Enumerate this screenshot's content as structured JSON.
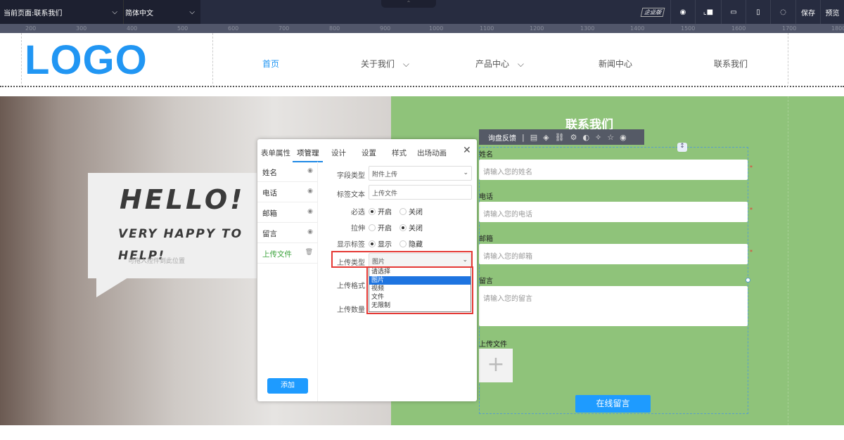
{
  "topbar": {
    "current_page": "当前页面:联系我们",
    "language": "简体中文",
    "edition_badge": "企业版",
    "save": "保存",
    "preview": "预览"
  },
  "ruler": [
    "200",
    "300",
    "400",
    "500",
    "600",
    "700",
    "800",
    "900",
    "1000",
    "1100",
    "1200",
    "1300",
    "1400",
    "1500",
    "1600",
    "1700",
    "1800"
  ],
  "header": {
    "logo": "LOGO",
    "nav": [
      "首页",
      "关于我们",
      "产品中心",
      "新闻中心",
      "联系我们"
    ],
    "active_color": "#2196f3"
  },
  "hero": {
    "hello": "HELLO!",
    "subtitle": "VERY HAPPY TO HELP!",
    "drop_hint": "可拖入控件到此位置"
  },
  "contact": {
    "title": "联系我们",
    "toolbar_label": "询盘反馈",
    "fields": [
      {
        "label": "姓名",
        "placeholder": "请输入您的姓名"
      },
      {
        "label": "电话",
        "placeholder": "请输入您的电话"
      },
      {
        "label": "邮箱",
        "placeholder": "请输入您的邮箱"
      },
      {
        "label": "留言",
        "placeholder": "请输入您的留言"
      }
    ],
    "upload_label": "上传文件",
    "submit": "在线留言",
    "accent": "#8fc37a"
  },
  "dialog": {
    "tabs": [
      "表单属性",
      "项管理",
      "设计",
      "设置",
      "样式",
      "出场动画"
    ],
    "active_tab": "项管理",
    "items": [
      "姓名",
      "电话",
      "邮箱",
      "留言",
      "上传文件"
    ],
    "add": "添加",
    "props": {
      "field_type_label": "字段类型",
      "field_type": "附件上传",
      "label_text_label": "标签文本",
      "label_text": "上传文件",
      "required_label": "必选",
      "stretch_label": "拉伸",
      "show_label_label": "显示标签",
      "on": "开启",
      "off": "关闭",
      "show": "显示",
      "hide": "隐藏",
      "upload_type_label": "上传类型",
      "upload_type": "图片",
      "upload_format_label": "上传格式",
      "upload_count_label": "上传数量",
      "options": [
        "请选择",
        "图片",
        "视频",
        "文件",
        "无限制"
      ]
    }
  }
}
